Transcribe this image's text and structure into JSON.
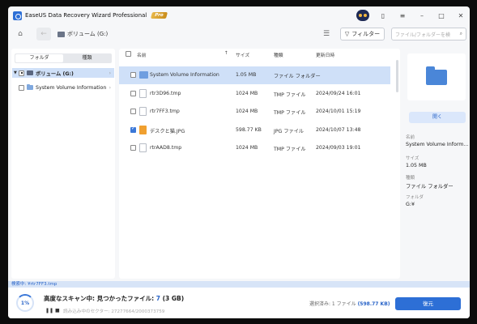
{
  "app": {
    "title": "EaseUS Data Recovery Wizard Professional",
    "badge": "Pro"
  },
  "navbar": {
    "crumb": "ボリューム (G:)",
    "filter_label": "フィルター",
    "search_placeholder": "ファイル/フォルダーを検"
  },
  "left": {
    "tabs": [
      "フォルダ",
      "種類"
    ],
    "active_tab": "フォルダ",
    "tree": [
      {
        "label": "ボリューム (G:)",
        "selected": true
      },
      {
        "label": "System Volume Information",
        "selected": false
      }
    ]
  },
  "list": {
    "headers": {
      "name": "名前",
      "size": "サイズ",
      "type": "種類",
      "date": "更新日時"
    },
    "rows": [
      {
        "name": "System Volume Information",
        "size": "1.05 MB",
        "type": "ファイル フォルダー",
        "date": "",
        "icon": "folder",
        "checked": false,
        "selected": true
      },
      {
        "name": "rtr3D96.tmp",
        "size": "1024 MB",
        "type": "TMP ファイル",
        "date": "2024/09/24 16:01",
        "icon": "file",
        "checked": false,
        "selected": false
      },
      {
        "name": "rtr7FF3.tmp",
        "size": "1024 MB",
        "type": "TMP ファイル",
        "date": "2024/10/01 15:19",
        "icon": "file",
        "checked": false,
        "selected": false
      },
      {
        "name": "デスクと猫.JPG",
        "size": "598.77 KB",
        "type": "JPG ファイル",
        "date": "2024/10/07 13:48",
        "icon": "jpg",
        "checked": true,
        "selected": false
      },
      {
        "name": "rtrAAD8.tmp",
        "size": "1024 MB",
        "type": "TMP ファイル",
        "date": "2024/09/03 19:01",
        "icon": "file",
        "checked": false,
        "selected": false
      }
    ]
  },
  "preview": {
    "open_label": "開く",
    "name_label": "名前",
    "name_value": "System Volume Inform...",
    "size_label": "サイズ",
    "size_value": "1.05 MB",
    "type_label": "種類",
    "type_value": "ファイル フォルダー",
    "folder_label": "フォルダ",
    "folder_value": "G:¥"
  },
  "footer": {
    "status_path": "検索中: ¥rtr7FF3.tmp",
    "progress_label": "1%",
    "progress_value": 0.01,
    "scan_prefix": "高度なスキャン中: 見つかったファイル: ",
    "scan_count": "7",
    "scan_suffix": " (3 GB)",
    "pause_icon": "❚❚",
    "stop_icon": "■",
    "sector_text": "読み込み中のセクター: 27277664/2000373759",
    "selected_prefix": "選択済み: 1 ファイル ",
    "selected_size": "(598.77 KB)",
    "recover_label": "復元"
  },
  "colors": {
    "accent": "#2d6fd6",
    "selection": "#cfe0f8"
  }
}
